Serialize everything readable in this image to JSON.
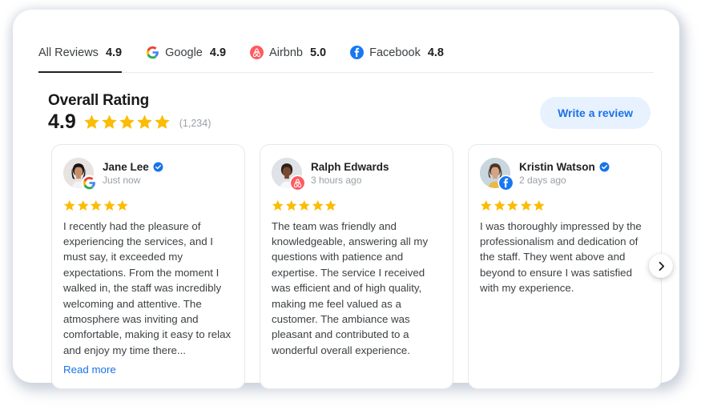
{
  "tabs": [
    {
      "label": "All Reviews",
      "score": "4.9",
      "icon": "none",
      "active": true
    },
    {
      "label": "Google",
      "score": "4.9",
      "icon": "google-icon",
      "active": false
    },
    {
      "label": "Airbnb",
      "score": "5.0",
      "icon": "airbnb-icon",
      "active": false
    },
    {
      "label": "Facebook",
      "score": "4.8",
      "icon": "facebook-icon",
      "active": false
    }
  ],
  "overall": {
    "title": "Overall Rating",
    "score": "4.9",
    "stars": 5,
    "count": "(1,234)"
  },
  "write_review_button": "Write a review",
  "next_arrow": "chevron-right-icon",
  "reviews": [
    {
      "name": "Jane Lee",
      "verified": true,
      "time": "Just now",
      "source": "google-icon",
      "stars": 5,
      "text": "I recently had the pleasure of experiencing the services, and I must say, it exceeded my expectations. From the moment I walked in, the staff was incredibly welcoming and attentive. The atmosphere was inviting and comfortable, making it easy to relax and enjoy my time there...",
      "read_more": "Read more"
    },
    {
      "name": "Ralph Edwards",
      "verified": false,
      "time": "3 hours ago",
      "source": "airbnb-icon",
      "stars": 5,
      "text": "The team was friendly and knowledgeable, answering all my questions with patience and expertise. The service I received was efficient and of high quality, making me feel valued as a customer. The ambiance was pleasant and contributed to a wonderful overall experience.",
      "read_more": ""
    },
    {
      "name": "Kristin Watson",
      "verified": true,
      "time": "2 days ago",
      "source": "facebook-icon",
      "stars": 5,
      "text": "I was thoroughly impressed by the professionalism and dedication of the staff. They went above and beyond to ensure I was satisfied with my experience.",
      "read_more": ""
    }
  ],
  "colors": {
    "star": "#FBBC04",
    "link": "#1a73e8",
    "button_bg": "#e8f1fe",
    "google_blue": "#4285F4",
    "airbnb_red": "#FF5A5F",
    "facebook_blue": "#1877F2",
    "verified_blue": "#1a73e8"
  }
}
